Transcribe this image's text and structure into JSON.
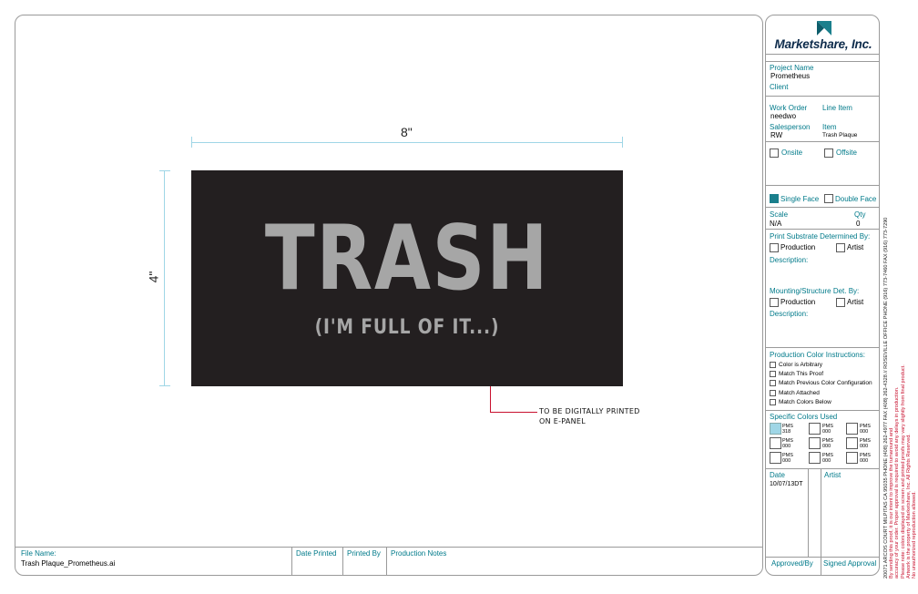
{
  "artwork": {
    "width_label": "8\"",
    "height_label": "4\"",
    "plaque_title": "TRASH",
    "plaque_subtitle": "(I'M FULL OF IT...)",
    "plaque_color": "#231f20",
    "text_color": "#a6a6a6",
    "note_line1": "TO BE DIGITALLY PRINTED",
    "note_line2": "ON E-PANEL"
  },
  "footer": {
    "file_name_label": "File Name:",
    "file_name_value": "Trash Plaque_Prometheus.ai",
    "date_printed_label": "Date Printed",
    "printed_by_label": "Printed By",
    "production_notes_label": "Production Notes"
  },
  "sidebar": {
    "company": "Marketshare, Inc.",
    "project_name_label": "Project Name",
    "project_name_value": "Prometheus",
    "client_label": "Client",
    "work_order_label": "Work Order",
    "work_order_value": "needwo",
    "line_item_label": "Line Item",
    "salesperson_label": "Salesperson",
    "salesperson_value": "RW",
    "item_label": "Item",
    "item_value": "Trash Plaque",
    "onsite_label": "Onsite",
    "offsite_label": "Offsite",
    "single_face_label": "Single Face",
    "double_face_label": "Double Face",
    "scale_label": "Scale",
    "scale_value": "N/A",
    "qty_label": "Qty",
    "qty_value": "0",
    "substrate_label": "Print Substrate Determined By:",
    "production_label": "Production",
    "artist_label": "Artist",
    "description_label": "Description:",
    "mounting_label": "Mounting/Structure Det. By:",
    "production_label_2": "Production",
    "artist_label_2": "Artist",
    "description_label_2": "Description:",
    "color_instructions_label": "Production Color Instructions:",
    "color_options": [
      "Color is Arbitrary",
      "Match This Proof",
      "Match Previous Color Configuration",
      "Match Attached",
      "Match Colors Below"
    ],
    "specific_colors_label": "Specific Colors Used",
    "pms_swatches": [
      {
        "top": "PMS",
        "bottom": "318"
      },
      {
        "top": "PMS",
        "bottom": "000"
      },
      {
        "top": "PMS",
        "bottom": "000"
      },
      {
        "top": "PMS",
        "bottom": "000"
      },
      {
        "top": "PMS",
        "bottom": "000"
      },
      {
        "top": "PMS",
        "bottom": "000"
      },
      {
        "top": "PMS",
        "bottom": "000"
      },
      {
        "top": "PMS",
        "bottom": "000"
      },
      {
        "top": "PMS",
        "bottom": "000"
      }
    ],
    "date_label": "Date",
    "date_value": "10/07/13DT",
    "artist_col_label": "Artist",
    "approved_label": "Approved/By",
    "signed_label": "Signed Approval"
  },
  "disclaimer": {
    "line1": "By sending this proof, it is our intent to improve the turnaround and",
    "line2": "accuracy of your order. Proper approval is required to avoid any delays in production.",
    "line3": "Please note: colors displayed on screen and printed proofs may vary slightly from final product.",
    "line4": "Artwork is the property of Marketshare, Inc. All Rights Reserved.",
    "line5": "No unauthorized reproduction allowed.",
    "address": "20071 ARCOS COURT MILPITAS CA 95035  PHONE (408) 262-4977  FAX (408) 262-4328 // ROSEVILLE OFFICE PHONE (916) 773-7460 FAX (916) 773-7290"
  }
}
